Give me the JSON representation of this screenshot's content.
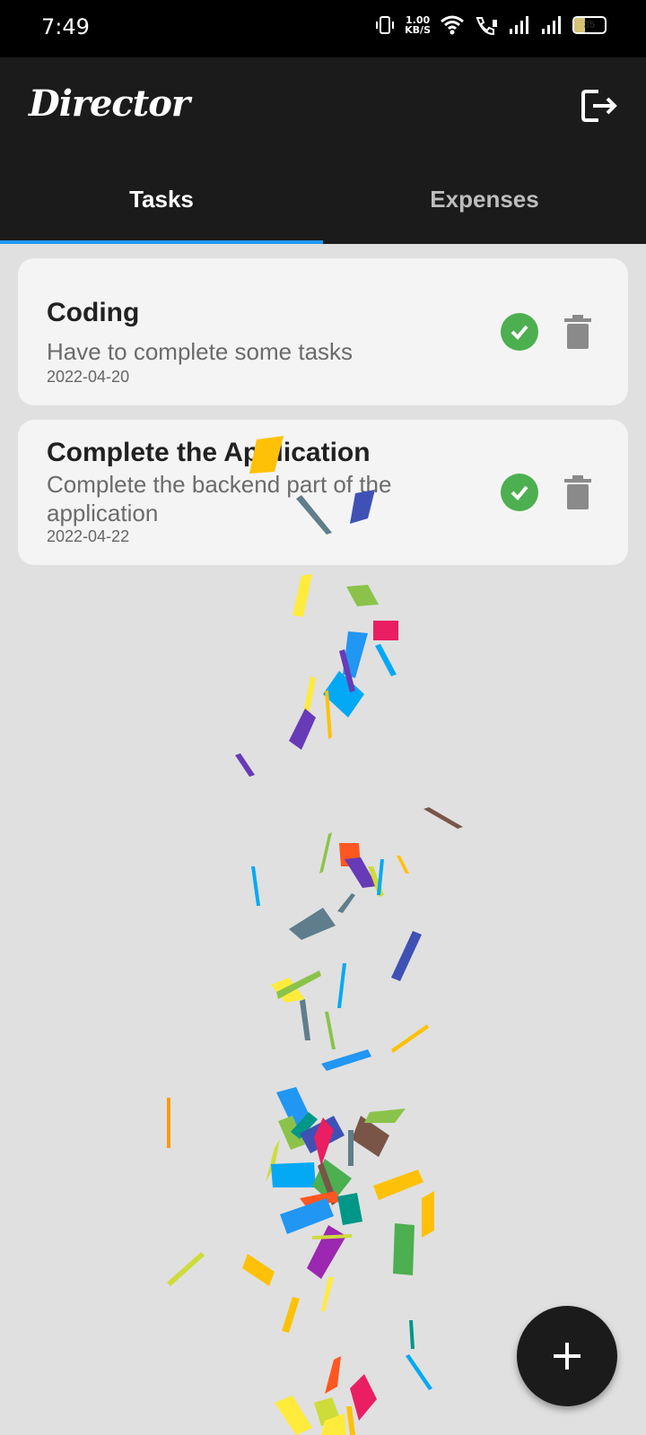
{
  "status_bar": {
    "time": "7:49",
    "net_speed_value": "1.00",
    "net_speed_unit": "KB/S",
    "battery_level": "35"
  },
  "app_bar": {
    "title": "Director",
    "logout_icon": "logout-icon"
  },
  "tabs": [
    {
      "label": "Tasks",
      "active": true
    },
    {
      "label": "Expenses",
      "active": false
    }
  ],
  "tasks": [
    {
      "title": "Coding",
      "description": "Have to complete some tasks",
      "date": "2022-04-20"
    },
    {
      "title": "Complete the Application",
      "description": "Complete the backend part of the application",
      "date": "2022-04-22"
    }
  ],
  "fab": {
    "icon": "plus-icon"
  },
  "colors": {
    "app_bar": "#1b1b1b",
    "tab_indicator": "#2196f3",
    "check": "#4caf50",
    "trash": "#8a8a8a",
    "background": "#e0e0e0"
  }
}
